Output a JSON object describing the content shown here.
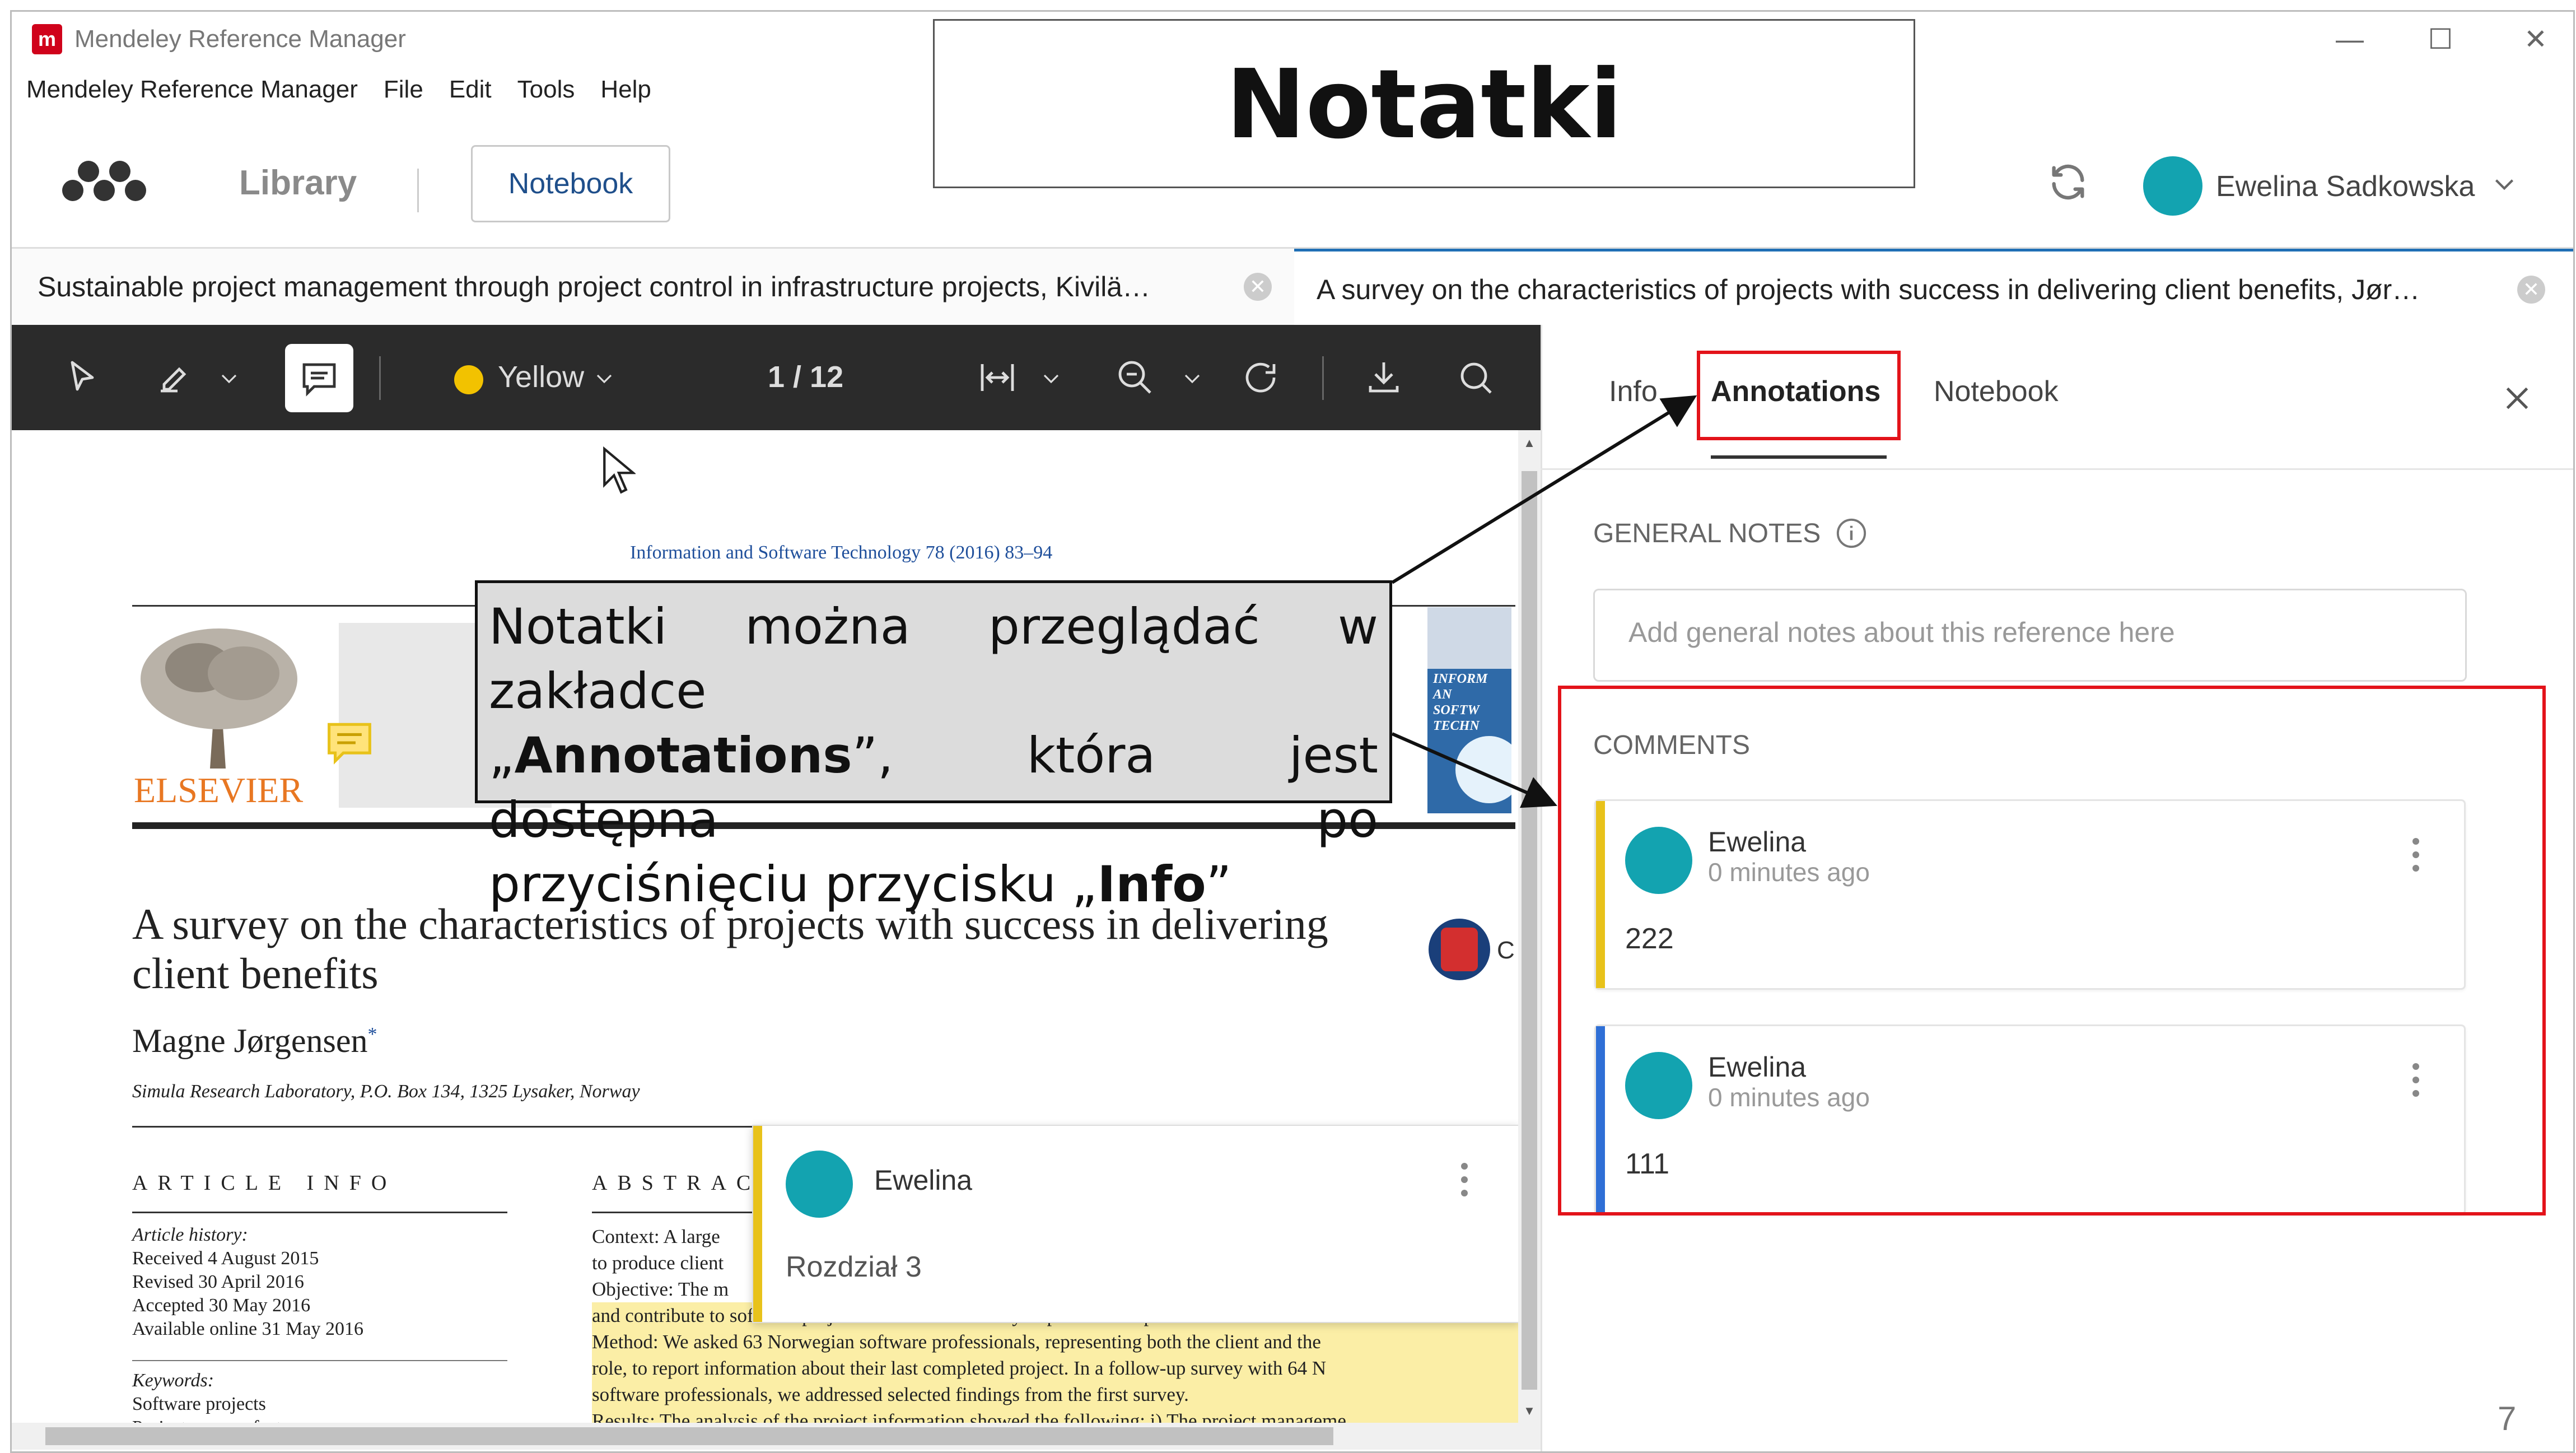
{
  "window": {
    "title": "Mendeley Reference Manager",
    "menu": [
      "Mendeley Reference Manager",
      "File",
      "Edit",
      "Tools",
      "Help"
    ]
  },
  "toolbar": {
    "library_label": "Library",
    "notebook_label": "Notebook",
    "user_name": "Ewelina Sadkowska"
  },
  "tabs": [
    {
      "label": "Sustainable project management through project control in infrastructure projects, Kivilä…"
    },
    {
      "label": "A survey on the characteristics of projects with success in delivering client benefits, Jør…"
    }
  ],
  "viewer": {
    "highlight_color": "Yellow",
    "page_indicator": "1 / 12"
  },
  "pdf": {
    "journal_line": "Information and Software Technology 78 (2016) 83–94",
    "publisher": "ELSEVIER",
    "cover_text": [
      "INFORM",
      "AN",
      "SOFTW",
      "TECHN"
    ],
    "title": "A survey on the characteristics of projects with success in delivering client benefits",
    "author": "Magne Jørgensen",
    "author_mark": "*",
    "affiliation": "Simula Research Laboratory, P.O. Box 134, 1325 Lysaker, Norway",
    "article_info_heading": "ARTICLE INFO",
    "abstract_heading": "ABSTRAC",
    "history": [
      "Article history:",
      "Received 4 August 2015",
      "Revised 30 April 2016",
      "Accepted 30 May 2016",
      "Available online 31 May 2016"
    ],
    "keywords": [
      "Keywords:",
      "Software projects",
      "Project success factors"
    ],
    "abstract_lines": [
      "Context:  A large",
      "to produce client",
      "Objective:  The m",
      "and contribute to software projects that are more likely to produce the planned client benefits.",
      "Method:  We asked 63 Norwegian software professionals, representing both the client and the",
      "role, to report information about their last completed project. In a follow-up survey with 64 N",
      "software professionals, we addressed selected findings from the first survey.",
      "Results:  The analysis of the project information showed the following: i) The project manageme"
    ],
    "cm_badge": "C"
  },
  "popup_comment": {
    "author": "Ewelina",
    "text": "Rozdział 3"
  },
  "panel": {
    "tabs": [
      "Info",
      "Annotations",
      "Notebook"
    ],
    "general_notes_heading": "GENERAL NOTES",
    "notes_placeholder": "Add general notes about this reference here",
    "comments_heading": "COMMENTS",
    "comments": [
      {
        "author": "Ewelina",
        "time": "0 minutes ago",
        "text": "222",
        "color": "#e8c21a"
      },
      {
        "author": "Ewelina",
        "time": "0 minutes ago",
        "text": "111",
        "color": "#2f6fd6"
      }
    ]
  },
  "slide": {
    "title": "Notatki",
    "callout_line1": "Notatki można przeglądać w zakładce",
    "callout_line2_pre": "„",
    "callout_line2_bold": "Annotations",
    "callout_line2_post": "”, która jest dostępna po",
    "callout_line3_pre": "przyciśnięciu przycisku „",
    "callout_line3_bold": "Info",
    "callout_line3_post": "”",
    "page_number": "7"
  }
}
